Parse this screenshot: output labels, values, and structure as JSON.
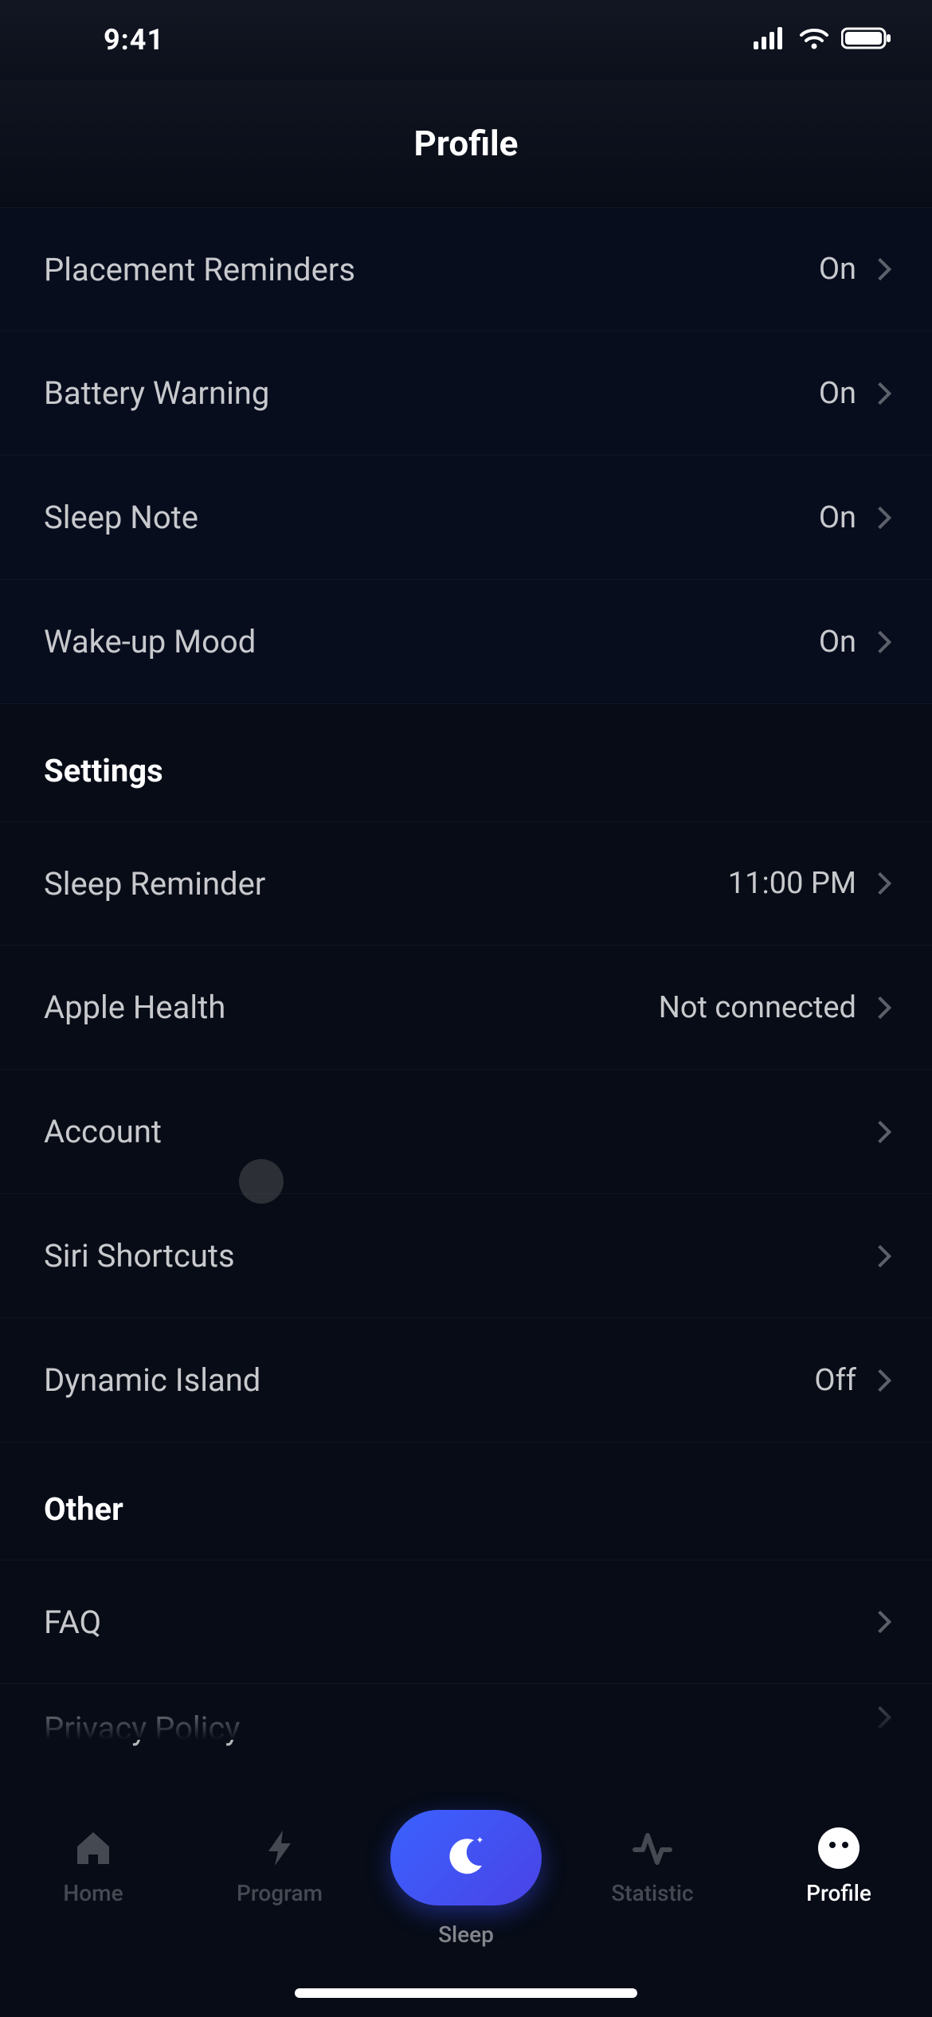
{
  "status": {
    "time": "9:41"
  },
  "header": {
    "title": "Profile"
  },
  "group1": [
    {
      "label": "Placement Reminders",
      "value": "On"
    },
    {
      "label": "Battery Warning",
      "value": "On"
    },
    {
      "label": "Sleep Note",
      "value": "On"
    },
    {
      "label": "Wake-up Mood",
      "value": "On"
    }
  ],
  "settings_title": "Settings",
  "settings": [
    {
      "label": "Sleep Reminder",
      "value": "11:00 PM"
    },
    {
      "label": "Apple Health",
      "value": "Not connected"
    },
    {
      "label": "Account",
      "value": ""
    },
    {
      "label": "Siri Shortcuts",
      "value": ""
    },
    {
      "label": "Dynamic Island",
      "value": "Off"
    }
  ],
  "other_title": "Other",
  "other": [
    {
      "label": "FAQ",
      "value": ""
    },
    {
      "label": "Privacy Policy",
      "value": ""
    }
  ],
  "tabs": {
    "home": "Home",
    "program": "Program",
    "sleep": "Sleep",
    "statistic": "Statistic",
    "profile": "Profile"
  }
}
